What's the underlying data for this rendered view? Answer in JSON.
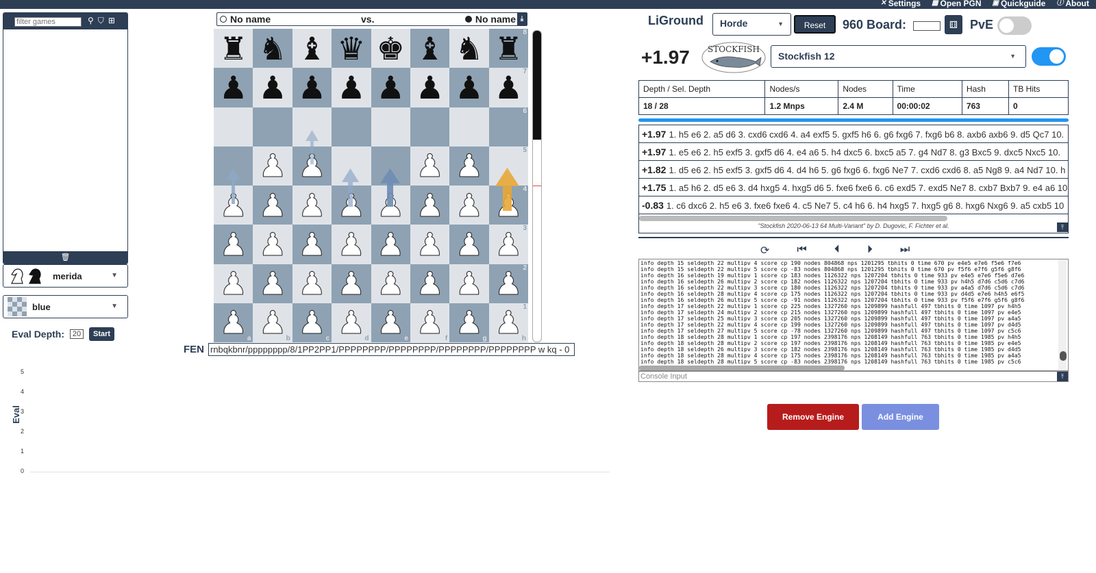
{
  "menu": [
    {
      "icon": "settings-icon",
      "glyph": "✕",
      "label": "Settings"
    },
    {
      "icon": "open-pgn-icon",
      "glyph": "▦",
      "label": "Open PGN"
    },
    {
      "icon": "quickguide-icon",
      "glyph": "▣",
      "label": "Quickguide"
    },
    {
      "icon": "about-icon",
      "glyph": "ⓘ",
      "label": "About"
    }
  ],
  "games": {
    "filter_placeholder": "filter games"
  },
  "piece_set": {
    "value": "merida"
  },
  "board_theme": {
    "value": "blue"
  },
  "eval_depth": {
    "label": "Eval Depth:",
    "value": "20",
    "start_label": "Start"
  },
  "graph": {
    "ylabel": "Eval",
    "ticks": [
      "5",
      "4",
      "3",
      "2",
      "1",
      "0"
    ]
  },
  "players": {
    "white": "No name",
    "vs": "vs.",
    "black": "No name"
  },
  "board": {
    "ranks": [
      [
        "r",
        "n",
        "b",
        "q",
        "k",
        "b",
        "n",
        "r"
      ],
      [
        "p",
        "p",
        "p",
        "p",
        "p",
        "p",
        "p",
        "p"
      ],
      [
        "",
        "",
        "",
        "",
        "",
        "",
        "",
        ""
      ],
      [
        "",
        "P",
        "P",
        "",
        "",
        "P",
        "P",
        ""
      ],
      [
        "P",
        "P",
        "P",
        "P",
        "P",
        "P",
        "P",
        "P"
      ],
      [
        "P",
        "P",
        "P",
        "P",
        "P",
        "P",
        "P",
        "P"
      ],
      [
        "P",
        "P",
        "P",
        "P",
        "P",
        "P",
        "P",
        "P"
      ],
      [
        "P",
        "P",
        "P",
        "P",
        "P",
        "P",
        "P",
        "P"
      ]
    ],
    "rank_labels": [
      "8",
      "7",
      "6",
      "5",
      "4",
      "3",
      "2",
      "1"
    ],
    "file_labels": [
      "a",
      "b",
      "c",
      "d",
      "e",
      "f",
      "g",
      "h"
    ]
  },
  "eval_bar": {
    "black_fraction": 0.35
  },
  "fen": {
    "label": "FEN",
    "value": "rnbqkbnr/pppppppp/8/1PP2PP1/PPPPPPPP/PPPPPPPP/PPPPPPPP/PPPPPPPP w kq - 0"
  },
  "header": {
    "brand": "LiGround",
    "variant": "Horde",
    "reset_label": "Reset",
    "board960_label": "960 Board:",
    "pve_label": "PvE"
  },
  "engine": {
    "score": "+1.97",
    "logo_text": "STOCKFISH",
    "name": "Stockfish 12",
    "enabled": true,
    "stats_headers": [
      "Depth / Sel. Depth",
      "Nodes/s",
      "Nodes",
      "Time",
      "Hash",
      "TB Hits"
    ],
    "stats_values": [
      "18 / 28",
      "1.2 Mnps",
      "2.4 M",
      "00:00:02",
      "763",
      "0"
    ],
    "pv": [
      {
        "score": "+1.97",
        "moves": "1. h5 e6 2. a5 d6 3. cxd6 cxd6 4. a4 exf5 5. gxf5 h6 6. g6 fxg6 7. fxg6 b6 8. axb6 axb6 9. d5 Qc7 10."
      },
      {
        "score": "+1.97",
        "moves": "1. e5 e6 2. h5 exf5 3. gxf5 d6 4. e4 a6 5. h4 dxc5 6. bxc5 a5 7. g4 Nd7 8. g3 Bxc5 9. dxc5 Nxc5 10."
      },
      {
        "score": "+1.82",
        "moves": "1. d5 e6 2. h5 exf5 3. gxf5 d6 4. d4 h6 5. g6 fxg6 6. fxg6 Ne7 7. cxd6 cxd6 8. a5 Ng8 9. a4 Nd7 10. h"
      },
      {
        "score": "+1.75",
        "moves": "1. a5 h6 2. d5 e6 3. d4 hxg5 4. hxg5 d6 5. fxe6 fxe6 6. c6 exd5 7. exd5 Ne7 8. cxb7 Bxb7 9. e4 a6 10"
      },
      {
        "score": "-0.83",
        "moves": "1. c6 dxc6 2. h5 e6 3. fxe6 fxe6 4. c5 Ne7 5. c4 h6 6. h4 hxg5 7. hxg5 g6 8. hxg6 Nxg6 9. a5 cxb5 10"
      }
    ],
    "credit": "\"Stockfish 2020-06-13 64 Multi-Variant\" by D. Dugovic, F. Fichter et al."
  },
  "console": {
    "lines": [
      "info depth 15 seldepth 22 multipv 4 score cp 190 nodes 804868 nps 1201295 tbhits 0 time 670 pv e4e5 e7e6 f5e6 f7e6",
      "info depth 15 seldepth 22 multipv 5 score cp -83 nodes 804868 nps 1201295 tbhits 0 time 670 pv f5f6 e7f6 g5f6 g8f6",
      "info depth 16 seldepth 19 multipv 1 score cp 183 nodes 1126322 nps 1207204 tbhits 0 time 933 pv e4e5 e7e6 f5e6 d7e6",
      "info depth 16 seldepth 26 multipv 2 score cp 182 nodes 1126322 nps 1207204 tbhits 0 time 933 pv h4h5 d7d6 c5d6 c7d6",
      "info depth 16 seldepth 22 multipv 3 score cp 180 nodes 1126322 nps 1207204 tbhits 0 time 933 pv a4a5 d7d6 c5d6 c7d6",
      "info depth 16 seldepth 28 multipv 4 score cp 175 nodes 1126322 nps 1207204 tbhits 0 time 933 pv d4d5 e7e6 h4h5 e6f5",
      "info depth 16 seldepth 26 multipv 5 score cp -91 nodes 1126322 nps 1207204 tbhits 0 time 933 pv f5f6 e7f6 g5f6 g8f6",
      "info depth 17 seldepth 22 multipv 1 score cp 225 nodes 1327260 nps 1209899 hashfull 497 tbhits 0 time 1097 pv h4h5",
      "info depth 17 seldepth 24 multipv 2 score cp 215 nodes 1327260 nps 1209899 hashfull 497 tbhits 0 time 1097 pv e4e5",
      "info depth 17 seldepth 25 multipv 3 score cp 205 nodes 1327260 nps 1209899 hashfull 497 tbhits 0 time 1097 pv a4a5",
      "info depth 17 seldepth 22 multipv 4 score cp 199 nodes 1327260 nps 1209899 hashfull 497 tbhits 0 time 1097 pv d4d5",
      "info depth 17 seldepth 27 multipv 5 score cp -78 nodes 1327260 nps 1209899 hashfull 497 tbhits 0 time 1097 pv c5c6",
      "info depth 18 seldepth 28 multipv 1 score cp 197 nodes 2398176 nps 1208149 hashfull 763 tbhits 0 time 1985 pv h4h5",
      "info depth 18 seldepth 28 multipv 2 score cp 197 nodes 2398176 nps 1208149 hashfull 763 tbhits 0 time 1985 pv e4e5",
      "info depth 18 seldepth 26 multipv 3 score cp 182 nodes 2398176 nps 1208149 hashfull 763 tbhits 0 time 1985 pv d4d5",
      "info depth 18 seldepth 28 multipv 4 score cp 175 nodes 2398176 nps 1208149 hashfull 763 tbhits 0 time 1985 pv a4a5",
      "info depth 18 seldepth 28 multipv 5 score cp -83 nodes 2398176 nps 1208149 hashfull 763 tbhits 0 time 1985 pv c5c6"
    ],
    "input_placeholder": "Console Input"
  },
  "buttons": {
    "remove": "Remove Engine",
    "add": "Add Engine"
  },
  "colors": {
    "brand": "#2d3e55",
    "light_square": "#dfe3e8",
    "dark_square": "#8ea2b3",
    "remove": "#b71c1c",
    "add": "#7b8fe0",
    "toggle_on": "#2196f3",
    "best_arrow": "#e8a838",
    "arrow": "#8fa8c8"
  }
}
